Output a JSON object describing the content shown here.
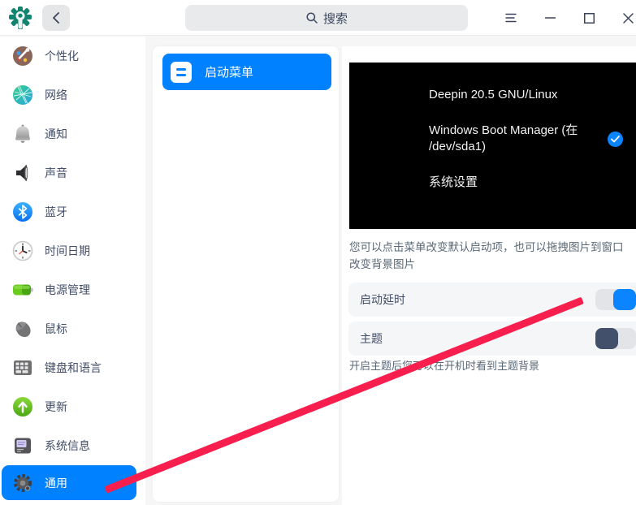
{
  "colors": {
    "accent": "#0081ff",
    "toggle_on": "#0a84ff",
    "toggle_off_knob": "#43506c",
    "arrow_annotation": "#f81f4e",
    "boot_preview_bg": "#000000",
    "sidebar_text": "#414d68"
  },
  "titlebar": {
    "search_placeholder": "搜索",
    "icons": [
      "back",
      "search",
      "menu",
      "minimize",
      "maximize",
      "close"
    ]
  },
  "sidebar": {
    "items": [
      {
        "label": "个性化",
        "icon": "personalization-icon",
        "selected": false
      },
      {
        "label": "网络",
        "icon": "network-icon",
        "selected": false
      },
      {
        "label": "通知",
        "icon": "notification-icon",
        "selected": false
      },
      {
        "label": "声音",
        "icon": "sound-icon",
        "selected": false
      },
      {
        "label": "蓝牙",
        "icon": "bluetooth-icon",
        "selected": false
      },
      {
        "label": "时间日期",
        "icon": "datetime-icon",
        "selected": false
      },
      {
        "label": "电源管理",
        "icon": "power-icon",
        "selected": false
      },
      {
        "label": "鼠标",
        "icon": "mouse-icon",
        "selected": false
      },
      {
        "label": "键盘和语言",
        "icon": "keyboard-icon",
        "selected": false
      },
      {
        "label": "更新",
        "icon": "update-icon",
        "selected": false
      },
      {
        "label": "系统信息",
        "icon": "sysinfo-icon",
        "selected": false
      },
      {
        "label": "通用",
        "icon": "general-icon",
        "selected": true
      }
    ]
  },
  "submenu": {
    "items": [
      {
        "label": "启动菜单",
        "icon": "boot-menu-icon",
        "selected": true
      }
    ]
  },
  "boot_preview": {
    "entries": [
      {
        "label": "Deepin 20.5 GNU/Linux",
        "selected": false
      },
      {
        "label": "Windows Boot Manager (在 /dev/sda1)",
        "selected": true
      },
      {
        "label": "系统设置",
        "selected": false
      }
    ]
  },
  "settings": {
    "hint": "您可以点击菜单改变默认启动项，也可以拖拽图片到窗口改变背景图片",
    "rows": [
      {
        "label": "启动延时",
        "state": "on"
      },
      {
        "label": "主题",
        "state": "off"
      }
    ],
    "theme_hint": "开启主题后您可以在开机时看到主题背景"
  }
}
